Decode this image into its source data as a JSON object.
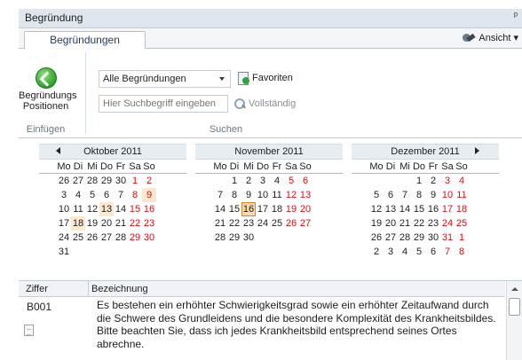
{
  "panel": {
    "title": "Begründung",
    "pin_icon": "pin-icon"
  },
  "tabs": [
    {
      "label": "Begründungen",
      "active": true
    }
  ],
  "view_menu": {
    "label": "Ansicht",
    "icon": "tools-icon"
  },
  "ribbon": {
    "insert_group": {
      "button_label_line1": "Begründungs",
      "button_label_line2": "Positionen",
      "group_label": "Einfügen",
      "icon": "green-arrow-icon"
    },
    "search_group": {
      "combo_value": "Alle Begründungen",
      "search_placeholder": "Hier Suchbegriff eingeben",
      "favorites_label": "Favoriten",
      "full_label": "Vollständig",
      "group_label": "Suchen"
    }
  },
  "colors": {
    "weekend": "#d41111",
    "highlight": "#fbe8cf",
    "today": "#fbd9a9",
    "accent_green": "#2f9f2a"
  },
  "calendar": {
    "weekday_headers": [
      "Mo",
      "Di",
      "Mi",
      "Do",
      "Fr",
      "Sa",
      "So"
    ],
    "months": [
      {
        "title": "Oktober 2011",
        "weeks": [
          [
            "26",
            "27",
            "28",
            "29",
            "30",
            "1",
            "2"
          ],
          [
            "3",
            "4",
            "5",
            "6",
            "7",
            "8",
            "9"
          ],
          [
            "10",
            "11",
            "12",
            "13",
            "14",
            "15",
            "16"
          ],
          [
            "17",
            "18",
            "19",
            "20",
            "21",
            "22",
            "23"
          ],
          [
            "24",
            "25",
            "26",
            "27",
            "28",
            "29",
            "30"
          ],
          [
            "31",
            "",
            "",
            "",
            "",
            "",
            ""
          ]
        ],
        "highlighted": [
          {
            "week": 1,
            "day": 6
          },
          {
            "week": 2,
            "day": 3
          },
          {
            "week": 3,
            "day": 1
          }
        ]
      },
      {
        "title": "November 2011",
        "weeks": [
          [
            "",
            "1",
            "2",
            "3",
            "4",
            "5",
            "6"
          ],
          [
            "7",
            "8",
            "9",
            "10",
            "11",
            "12",
            "13"
          ],
          [
            "14",
            "15",
            "16",
            "17",
            "18",
            "19",
            "20"
          ],
          [
            "21",
            "22",
            "23",
            "24",
            "25",
            "26",
            "27"
          ],
          [
            "28",
            "29",
            "30",
            "",
            "",
            "",
            ""
          ],
          [
            "",
            "",
            "",
            "",
            "",
            "",
            ""
          ]
        ],
        "today": {
          "week": 2,
          "day": 2
        },
        "highlighted": []
      },
      {
        "title": "Dezember 2011",
        "weeks": [
          [
            "",
            "",
            "",
            "1",
            "2",
            "3",
            "4"
          ],
          [
            "5",
            "6",
            "7",
            "8",
            "9",
            "10",
            "11"
          ],
          [
            "12",
            "13",
            "14",
            "15",
            "16",
            "17",
            "18"
          ],
          [
            "19",
            "20",
            "21",
            "22",
            "23",
            "24",
            "25"
          ],
          [
            "26",
            "27",
            "28",
            "29",
            "30",
            "31",
            "1"
          ],
          [
            "2",
            "3",
            "4",
            "5",
            "6",
            "7",
            "8"
          ]
        ],
        "highlighted": []
      }
    ]
  },
  "grid": {
    "columns": [
      "Ziffer",
      "Bezeichnung"
    ],
    "rows": [
      {
        "code": "B001",
        "text": "Es bestehen ein erhöhter Schwierigkeitsgrad sowie ein erhöhter Zeitaufwand durch die Schwere des Grundleidens und die besondere Komplexität des Krankheitsbildes. Bitte beachten Sie, dass ich jedes Krankheitsbild entsprechend seines Ortes abrechne."
      }
    ]
  }
}
